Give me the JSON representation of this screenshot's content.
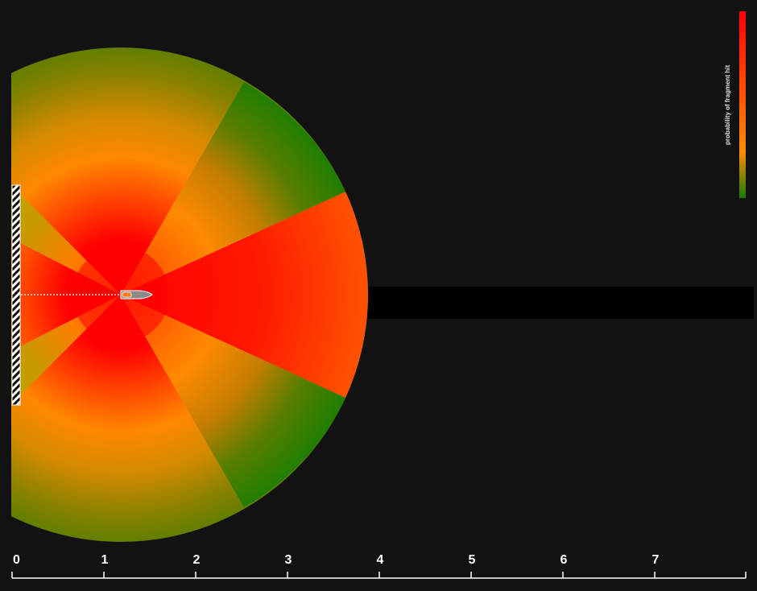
{
  "legend": {
    "title": "probability of fragment hit",
    "colors": [
      "#ff0000",
      "#ff8c00",
      "#1a7a00"
    ]
  },
  "colors": {
    "background": "#121212",
    "high": "#ff0000",
    "mid": "#ff8c00",
    "low": "#1a7a00",
    "axis": "#ffffff"
  },
  "axis": {
    "ticks": [
      "0",
      "1",
      "2",
      "3",
      "4",
      "5",
      "6",
      "7"
    ]
  },
  "diagram": {
    "wall": "hatched-wall",
    "projectile": "projectile-icon",
    "trajectory": "dotted-trajectory"
  }
}
